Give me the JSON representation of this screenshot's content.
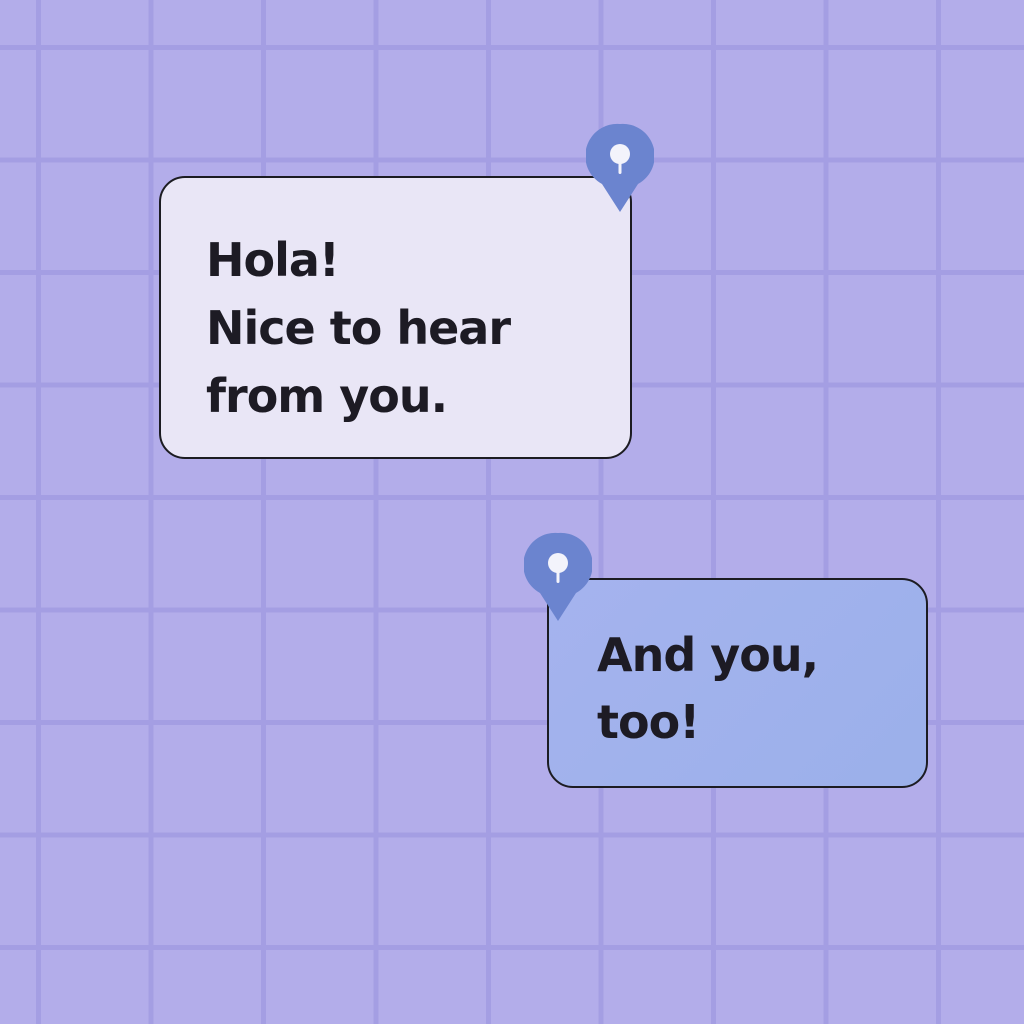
{
  "messages": [
    {
      "lines": [
        "Hola!",
        "Nice to hear",
        "from you."
      ],
      "pin_icon": "location-pin-icon"
    },
    {
      "lines": [
        "And you,",
        "too!"
      ],
      "pin_icon": "location-pin-icon"
    }
  ],
  "colors": {
    "background": "#b3adea",
    "grid_lines": "#a49ee3",
    "bubble_1_fill": "#e9e6f6",
    "bubble_2_fill": "#a5b3ee",
    "pin_fill": "#6b84cf",
    "pin_head": "#f3f3fb",
    "text": "#1d1b24"
  }
}
